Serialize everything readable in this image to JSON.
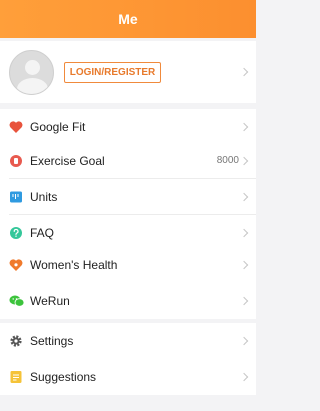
{
  "header": {
    "title": "Me"
  },
  "profile": {
    "login_label": "LOGIN/REGISTER"
  },
  "menu": {
    "google_fit": "Google Fit",
    "exercise_goal": "Exercise Goal",
    "exercise_goal_value": "8000",
    "units": "Units",
    "faq": "FAQ",
    "womens_health": "Women's Health",
    "werun": "WeRun",
    "settings": "Settings",
    "suggestions": "Suggestions"
  },
  "icons": {
    "google_fit": "heart-icon",
    "exercise_goal": "target-icon",
    "units": "ruler-icon",
    "faq": "question-icon",
    "womens_health": "flower-heart-icon",
    "werun": "wechat-icon",
    "settings": "gear-icon",
    "suggestions": "note-icon"
  },
  "colors": {
    "header": "#fc9434",
    "accent": "#f08a3c",
    "google_fit": "#e8533c",
    "exercise_goal": "#e85a4f",
    "units": "#2f9ae0",
    "faq": "#34c79a",
    "womens_health": "#f07a2c",
    "werun": "#3cc33c",
    "settings": "#555555",
    "suggestions": "#f5c338"
  }
}
